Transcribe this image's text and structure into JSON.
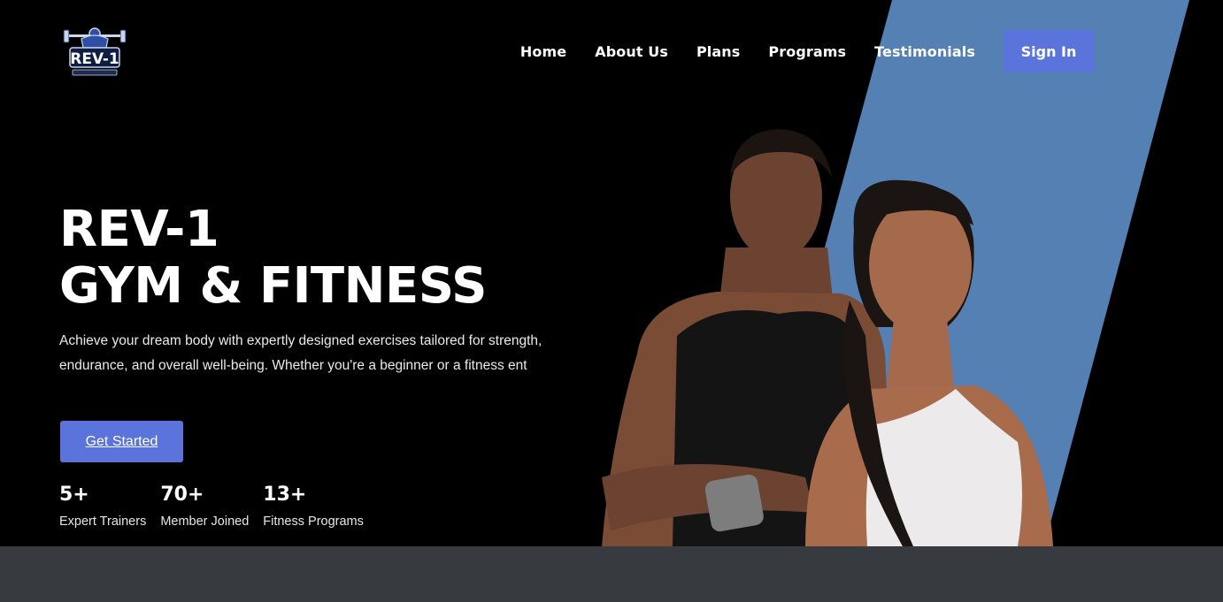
{
  "brand": {
    "logo_text": "REV-1",
    "accent_color": "#5a74db",
    "stripe_color": "#5480b4"
  },
  "nav": {
    "items": [
      {
        "label": "Home"
      },
      {
        "label": "About Us"
      },
      {
        "label": "Plans"
      },
      {
        "label": "Programs"
      },
      {
        "label": "Testimonials"
      }
    ],
    "signin_label": "Sign In"
  },
  "hero": {
    "title_line1": "REV-1",
    "title_line2": "GYM & FITNESS",
    "description": "Achieve your dream body with expertly designed exercises tailored for strength, endurance, and overall well-being. Whether you're a beginner or a fitness ent",
    "cta_label": "Get Started",
    "image_icon": "athletes-image"
  },
  "stats": [
    {
      "value": "5+",
      "label": "Expert Trainers"
    },
    {
      "value": "70+",
      "label": "Member Joined"
    },
    {
      "value": "13+",
      "label": "Fitness Programs"
    }
  ]
}
